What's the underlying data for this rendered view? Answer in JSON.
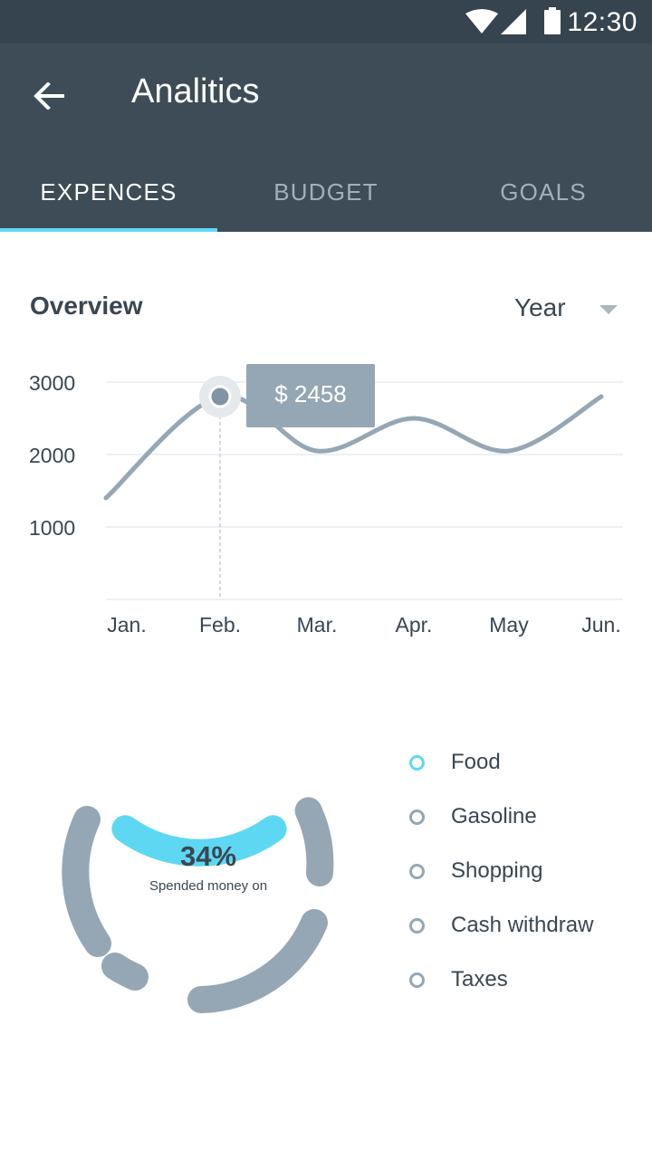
{
  "status_bar": {
    "time": "12:30",
    "icons": [
      "wifi-icon",
      "signal-icon",
      "battery-icon"
    ]
  },
  "app_bar": {
    "title": "Analitics",
    "back_icon": "arrow-left-icon"
  },
  "tabs": [
    {
      "label": "EXPENCES",
      "active": true
    },
    {
      "label": "BUDGET",
      "active": false
    },
    {
      "label": "GOALS",
      "active": false
    }
  ],
  "overview": {
    "title": "Overview",
    "period": "Year"
  },
  "chart_data": {
    "type": "line",
    "categories": [
      "Jan.",
      "Feb.",
      "Mar.",
      "Apr.",
      "May",
      "Jun."
    ],
    "values": [
      1400,
      2800,
      2050,
      2500,
      2050,
      2800
    ],
    "ylim": [
      0,
      3000
    ],
    "yticks": [
      1000,
      2000,
      3000
    ],
    "ytick_labels": [
      "1000",
      "2000",
      "3000"
    ],
    "grid": true,
    "highlight": {
      "index": 1,
      "label": "$ 2458"
    },
    "line_color": "#95a7b4"
  },
  "donut": {
    "percent_label": "34%",
    "subtitle": "Spended money on",
    "highlight_color": "#5ed8f2",
    "base_color": "#95a7b4"
  },
  "legend": [
    {
      "label": "Food",
      "active": true
    },
    {
      "label": "Gasoline",
      "active": false
    },
    {
      "label": "Shopping",
      "active": false
    },
    {
      "label": "Cash withdraw",
      "active": false
    },
    {
      "label": "Taxes",
      "active": false
    }
  ]
}
